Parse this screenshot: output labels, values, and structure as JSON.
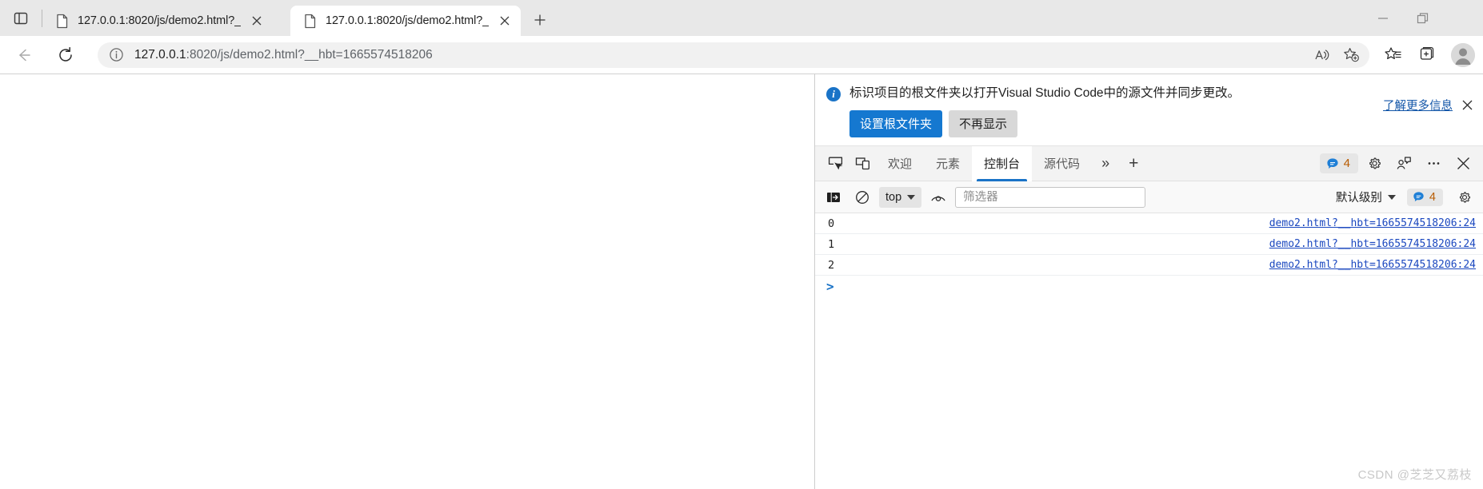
{
  "browser": {
    "tabs": [
      {
        "title": "127.0.0.1:8020/js/demo2.html?_",
        "active": false,
        "favicon": "page-icon",
        "close_label": "×"
      },
      {
        "title": "127.0.0.1:8020/js/demo2.html?_",
        "active": true,
        "favicon": "page-icon",
        "close_label": "×"
      }
    ],
    "new_tab_label": "+",
    "tab_search_icon": "tab-actions-icon",
    "window_controls": {
      "minimize": "minimize-icon",
      "restore": "restore-icon",
      "close": "close-icon"
    },
    "nav": {
      "back_icon": "back-arrow-icon",
      "refresh_icon": "reload-icon"
    },
    "omnibox": {
      "info_icon": "site-information-icon",
      "url_host": "127.0.0.1",
      "url_rest": ":8020/js/demo2.html?__hbt=1665574518206",
      "url_full": "127.0.0.1:8020/js/demo2.html?__hbt=1665574518206",
      "read_aloud_icon": "read-aloud-icon",
      "add_favorite_icon": "add-favorite-icon"
    },
    "toolbar": {
      "favorites_icon": "favorites-icon",
      "collections_icon": "collections-icon",
      "profile_icon": "profile-avatar-icon"
    }
  },
  "devtools": {
    "infobar": {
      "icon": "info-icon",
      "message": "标识项目的根文件夹以打开Visual Studio Code中的源文件并同步更改。",
      "primary_button": "设置根文件夹",
      "secondary_button": "不再显示",
      "learn_more": "了解更多信息",
      "close_label": "×"
    },
    "tabbar": {
      "inspect_icon": "inspect-element-icon",
      "device_icon": "device-emulation-icon",
      "tabs": [
        {
          "label": "欢迎",
          "active": false
        },
        {
          "label": "元素",
          "active": false
        },
        {
          "label": "控制台",
          "active": true
        },
        {
          "label": "源代码",
          "active": false
        }
      ],
      "overflow_label": "»",
      "add_panel_label": "+",
      "issues_count": "4",
      "issues_icon": "issues-message-icon",
      "settings_icon": "settings-gear-icon",
      "feedback_icon": "feedback-icon",
      "more_icon": "more-options-icon",
      "close_icon": "close-devtools-icon"
    },
    "console_toolbar": {
      "sidebar_icon": "console-sidebar-icon",
      "clear_icon": "clear-console-icon",
      "context_value": "top",
      "eye_icon": "live-expression-icon",
      "filter_placeholder": "筛选器",
      "filter_value": "",
      "level_value": "默认级别",
      "issues_count": "4",
      "issues_icon": "issues-message-icon",
      "settings_icon": "console-settings-icon"
    },
    "console_logs": [
      {
        "message": "0",
        "source": "demo2.html?__hbt=1665574518206:24"
      },
      {
        "message": "1",
        "source": "demo2.html?__hbt=1665574518206:24"
      },
      {
        "message": "2",
        "source": "demo2.html?__hbt=1665574518206:24"
      }
    ],
    "prompt_caret": ">"
  },
  "watermark": "CSDN @芝芝又荔枝",
  "colors": {
    "accent_blue": "#1578d0",
    "link_blue": "#1a47bf",
    "tab_active_underline": "#1a73c7",
    "issue_count_orange": "#b85b00",
    "chrome_bg": "#e8e8e8",
    "devtools_tabbar_bg": "#f3f3f3"
  }
}
